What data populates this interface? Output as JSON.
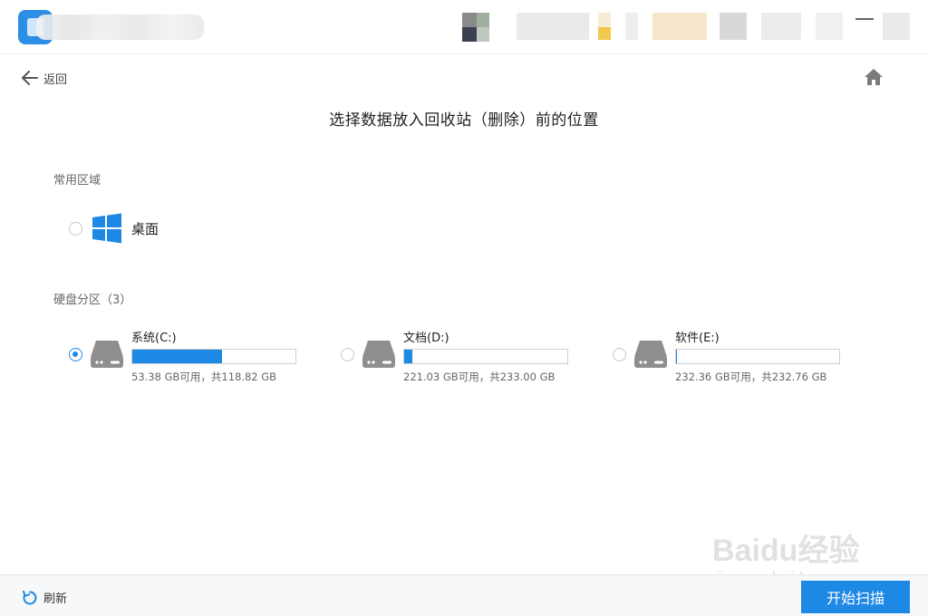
{
  "header": {
    "back_label": "返回",
    "page_title": "选择数据放入回收站（删除）前的位置"
  },
  "common_area": {
    "label": "常用区域",
    "desktop": {
      "label": "桌面",
      "icon": "windows-icon",
      "selected": false
    }
  },
  "partitions": {
    "label": "硬盘分区（3）",
    "drives": [
      {
        "name": "系统(C:)",
        "info": "53.38 GB可用，共118.82 GB",
        "used_fraction": 0.551,
        "selected": true,
        "icon": "hard-drive-icon"
      },
      {
        "name": "文档(D:)",
        "info": "221.03 GB可用，共233.00 GB",
        "used_fraction": 0.051,
        "selected": false,
        "icon": "hard-drive-icon"
      },
      {
        "name": "软件(E:)",
        "info": "232.36 GB可用，共232.76 GB",
        "used_fraction": 0.002,
        "selected": false,
        "icon": "hard-drive-icon"
      }
    ]
  },
  "footer": {
    "refresh_label": "刷新",
    "start_scan_label": "开始扫描"
  },
  "watermark": {
    "text": "Baidu经验",
    "url": "jingyan.baidu.com"
  },
  "colors": {
    "accent": "#1e88e5",
    "footer_bg": "#f7f8fa"
  }
}
